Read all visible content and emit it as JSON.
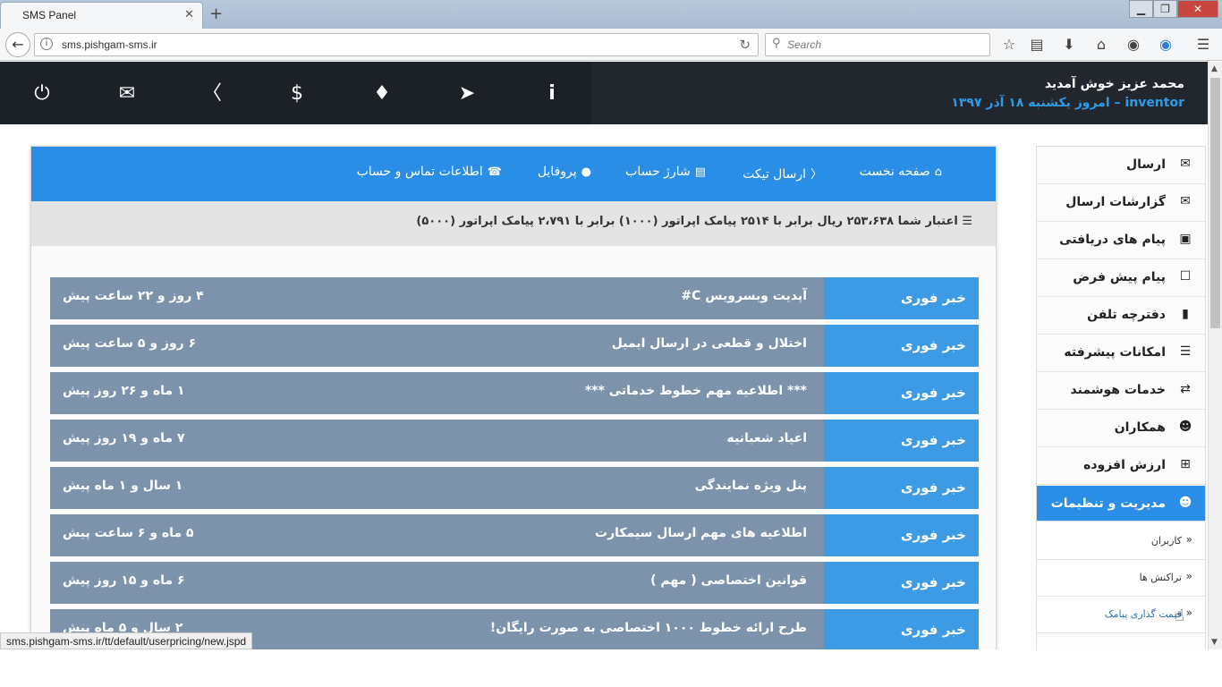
{
  "browser": {
    "tab_title": "SMS Panel",
    "tab_close": "✕",
    "new_tab": "+",
    "url": "sms.pishgam-sms.ir",
    "search_placeholder": "Search",
    "status_url": "sms.pishgam-sms.ir/tt/default/userpricing/new.jspd",
    "window_controls": {
      "minimize": "▁",
      "maximize": "❐",
      "close": "✕"
    }
  },
  "header": {
    "welcome": "محمد عزیز خوش آمدید",
    "username": "inventor",
    "date_text": "– امروز یکشنبه ۱۸ آذر ۱۳۹۷",
    "icons": [
      "power-icon",
      "mail-icon",
      "ticket-icon",
      "dollar-icon",
      "bell-icon",
      "send-icon",
      "info-icon"
    ]
  },
  "topnav": {
    "home": "صفحه نخست",
    "ticket": "ارسال تیکت",
    "charge": "شارژ حساب",
    "profile": "پروفایل",
    "contact": "اطلاعات تماس و حساب"
  },
  "credit_text": "اعتبار شما ۲۵۳،۶۳۸ ریال برابر با ۲۵۱۴ پیامک اپراتور (۱۰۰۰) برابر با ۲،۷۹۱ پیامک اپراتور (۵۰۰۰)",
  "news": [
    {
      "badge": "خبر فوری",
      "title": "آپدیت وبسرویس C#",
      "time": "۴ روز و ۲۲ ساعت پیش"
    },
    {
      "badge": "خبر فوری",
      "title": "اختلال و قطعی در ارسال ایمیل",
      "time": "۶ روز و ۵ ساعت پیش"
    },
    {
      "badge": "خبر فوری",
      "title": "*** اطلاعیه مهم خطوط خدماتی ***",
      "time": "۱ ماه و ۲۶ روز پیش"
    },
    {
      "badge": "خبر فوری",
      "title": "اعیاد شعبانیه",
      "time": "۷ ماه و ۱۹ روز پیش"
    },
    {
      "badge": "خبر فوری",
      "title": "پنل ویژه نمایندگی",
      "time": "۱ سال و ۱ ماه پیش"
    },
    {
      "badge": "خبر فوری",
      "title": "اطلاعیه های مهم ارسال سیمکارت",
      "time": "۵ ماه و ۶ ساعت پیش"
    },
    {
      "badge": "خبر فوری",
      "title": "قوانین اختصاصی ( مهم )",
      "time": "۶ ماه و ۱۵ روز پیش"
    },
    {
      "badge": "خبر فوری",
      "title": "طرح ارائه خطوط ۱۰۰۰ اختصاصی به صورت رایگان!",
      "time": "۲ سال و ۵ ماه پیش"
    }
  ],
  "sidebar": {
    "items": [
      {
        "label": "ارسال",
        "icon": "envelope-icon"
      },
      {
        "label": "گزارشات ارسال",
        "icon": "envelope-outline-icon"
      },
      {
        "label": "پیام های دریافتی",
        "icon": "inbox-icon"
      },
      {
        "label": "پیام پیش فرض",
        "icon": "square-icon"
      },
      {
        "label": "دفترچه تلفن",
        "icon": "book-icon"
      },
      {
        "label": "امکانات پیشرفته",
        "icon": "list-icon"
      },
      {
        "label": "خدمات هوشمند",
        "icon": "retweet-icon"
      },
      {
        "label": "همکاران",
        "icon": "user-tie-icon"
      },
      {
        "label": "ارزش افزوده",
        "icon": "plus-square-icon"
      },
      {
        "label": "مدیریت و تنظیمات",
        "icon": "users-icon"
      }
    ],
    "subitems": [
      {
        "label": "کاربران"
      },
      {
        "label": "تراکنش ها"
      },
      {
        "label": "قیمت گذاری پیامک"
      }
    ]
  }
}
